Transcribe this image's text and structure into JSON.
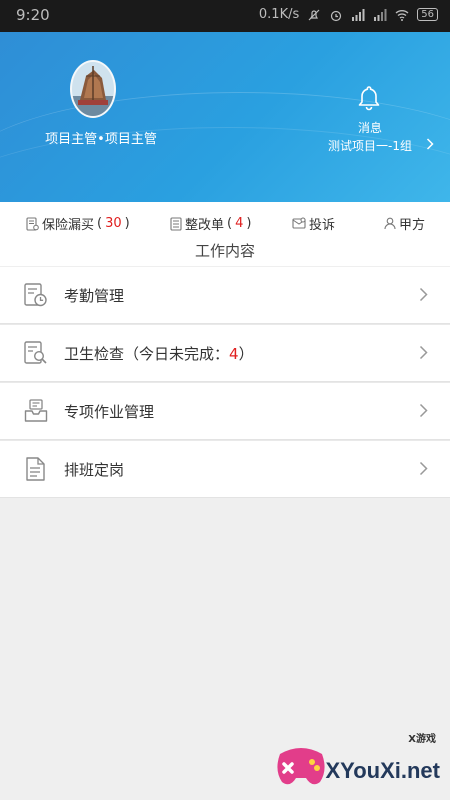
{
  "status_bar": {
    "time": "9:20",
    "speed": "0.1K/s",
    "battery": "56"
  },
  "header": {
    "user_role": "项目主管•项目主管",
    "message_label": "消息",
    "project_name": "测试项目一-1组"
  },
  "quick_actions": [
    {
      "label": "保险漏买",
      "count": "30",
      "icon": "insurance-icon"
    },
    {
      "label": "整改单",
      "count": "4",
      "icon": "rectification-icon"
    },
    {
      "label": "投诉",
      "icon": "complaint-icon"
    },
    {
      "label": "甲方",
      "icon": "client-icon"
    }
  ],
  "section_title": "工作内容",
  "menu": [
    {
      "label": "考勤管理",
      "icon": "attendance-icon"
    },
    {
      "label": "卫生检查（今日未完成：",
      "count": "4",
      "suffix": "）",
      "icon": "hygiene-check-icon"
    },
    {
      "label": "专项作业管理",
      "icon": "special-task-icon"
    },
    {
      "label": "排班定岗",
      "icon": "schedule-icon"
    }
  ],
  "watermark": {
    "site": "XYouXi.net",
    "tag": "X游戏"
  },
  "colors": {
    "header_blue": "#2a9ade",
    "alert_red": "#e02020"
  }
}
